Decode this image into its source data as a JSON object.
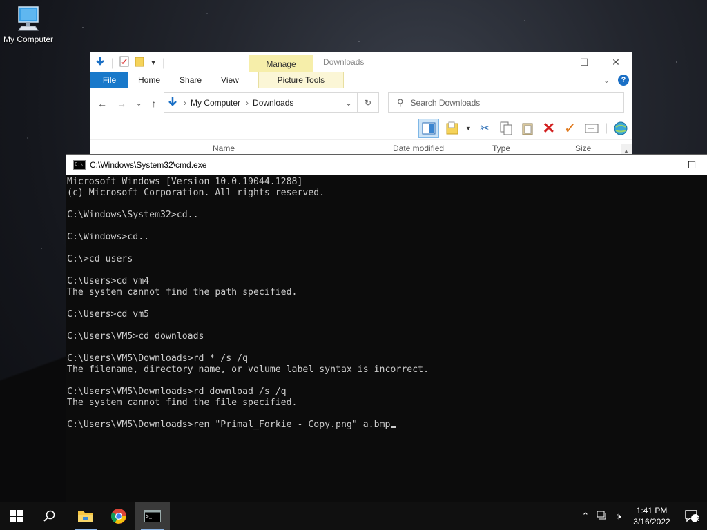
{
  "desktop": {
    "icon_label": "My Computer"
  },
  "explorer": {
    "title": "Downloads",
    "context_tab": "Manage",
    "tabs": [
      "File",
      "Home",
      "Share",
      "View",
      "Picture Tools"
    ],
    "address": [
      "My Computer",
      "Downloads"
    ],
    "search_placeholder": "Search Downloads",
    "columns": [
      "Name",
      "Date modified",
      "Type",
      "Size"
    ],
    "help_label": "?"
  },
  "cmd": {
    "title": "C:\\Windows\\System32\\cmd.exe",
    "lines": [
      "Microsoft Windows [Version 10.0.19044.1288]",
      "(c) Microsoft Corporation. All rights reserved.",
      "",
      "C:\\Windows\\System32>cd..",
      "",
      "C:\\Windows>cd..",
      "",
      "C:\\>cd users",
      "",
      "C:\\Users>cd vm4",
      "The system cannot find the path specified.",
      "",
      "C:\\Users>cd vm5",
      "",
      "C:\\Users\\VM5>cd downloads",
      "",
      "C:\\Users\\VM5\\Downloads>rd * /s /q",
      "The filename, directory name, or volume label syntax is incorrect.",
      "",
      "C:\\Users\\VM5\\Downloads>rd download /s /q",
      "The system cannot find the file specified.",
      "",
      "C:\\Users\\VM5\\Downloads>ren \"Primal_Forkie - Copy.png\" a.bmp"
    ]
  },
  "taskbar": {
    "time": "1:41 PM",
    "date": "3/16/2022",
    "notification_count": "2"
  },
  "colors": {
    "accent": "#1979ca",
    "manage_tab": "#f6eeaa",
    "console_bg": "#0c0c0c",
    "console_fg": "#cccccc"
  }
}
